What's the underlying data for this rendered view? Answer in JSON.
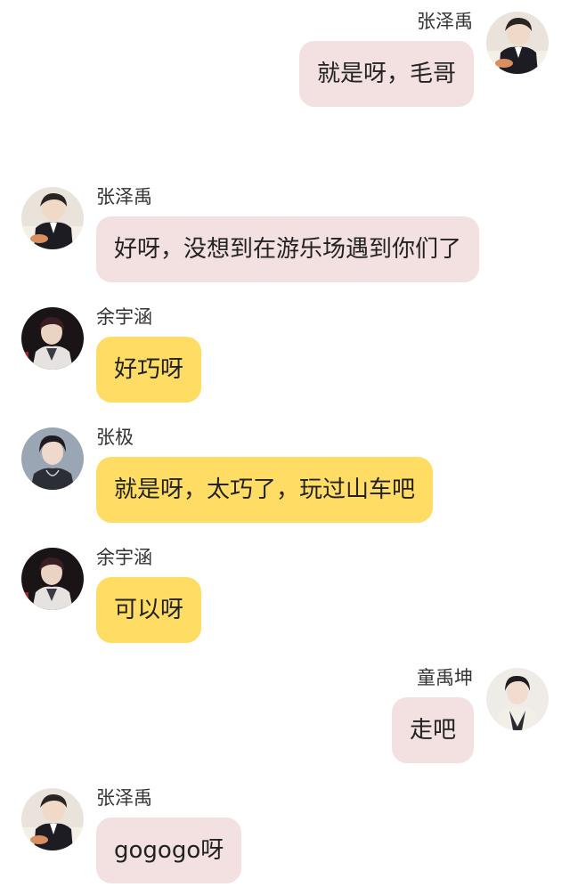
{
  "colors": {
    "pink_bubble": "#f3e0e0",
    "yellow_bubble": "#ffdc64",
    "background": "#ffffff"
  },
  "messages": [
    {
      "sender": "张泽禹",
      "text": "就是呀，毛哥",
      "side": "right",
      "bubble": "pink",
      "avatar": "avatar-zhangzeyu"
    },
    {
      "sender": "张泽禹",
      "text": "好呀，没想到在游乐场遇到你们了",
      "side": "left",
      "bubble": "pink",
      "avatar": "avatar-zhangzeyu"
    },
    {
      "sender": "余宇涵",
      "text": "好巧呀",
      "side": "left",
      "bubble": "yellow",
      "avatar": "avatar-yuyuhan"
    },
    {
      "sender": "张极",
      "text": "就是呀，太巧了，玩过山车吧",
      "side": "left",
      "bubble": "yellow",
      "avatar": "avatar-zhangji"
    },
    {
      "sender": "余宇涵",
      "text": "可以呀",
      "side": "left",
      "bubble": "yellow",
      "avatar": "avatar-yuyuhan"
    },
    {
      "sender": "童禹坤",
      "text": "走吧",
      "side": "right",
      "bubble": "pink",
      "avatar": "avatar-tongyukun"
    },
    {
      "sender": "张泽禹",
      "text": "gogogo呀",
      "side": "left",
      "bubble": "pink",
      "avatar": "avatar-zhangzeyu"
    }
  ]
}
